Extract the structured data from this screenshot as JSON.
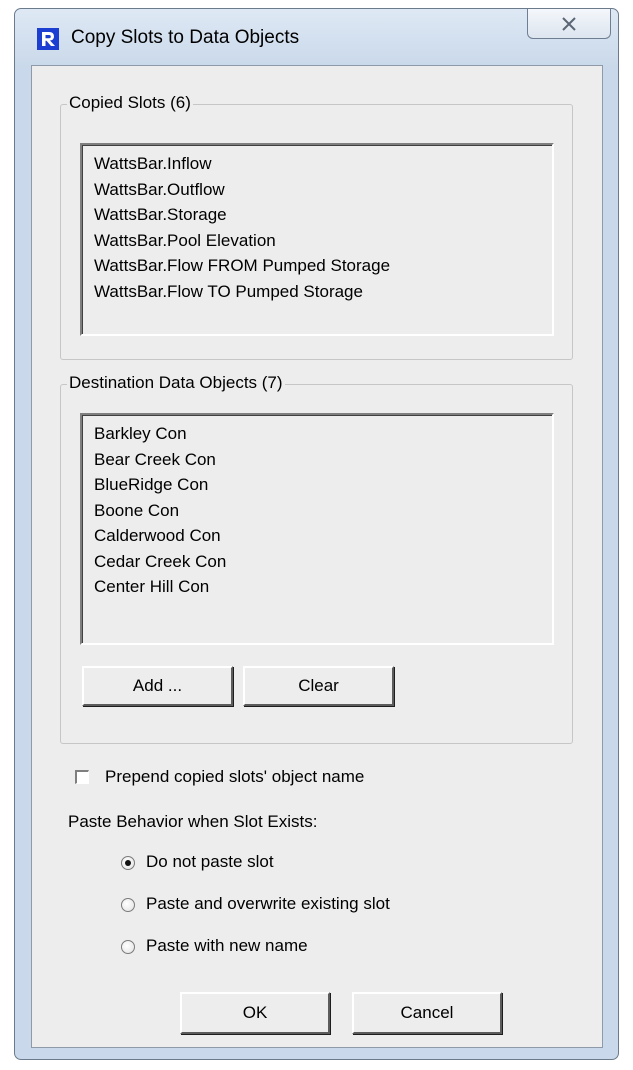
{
  "window": {
    "title": "Copy Slots to Data Objects"
  },
  "copied_slots": {
    "title": "Copied Slots (6)",
    "items": [
      "WattsBar.Inflow",
      "WattsBar.Outflow",
      "WattsBar.Storage",
      "WattsBar.Pool Elevation",
      "WattsBar.Flow FROM Pumped Storage",
      "WattsBar.Flow TO Pumped Storage"
    ]
  },
  "destination": {
    "title": "Destination Data Objects (7)",
    "items": [
      "Barkley Con",
      "Bear Creek Con",
      "BlueRidge Con",
      "Boone Con",
      "Calderwood Con",
      "Cedar Creek Con",
      "Center Hill Con"
    ],
    "add_label": "Add ...",
    "clear_label": "Clear"
  },
  "prepend": {
    "label": "Prepend copied slots' object name",
    "checked": false
  },
  "paste_behavior": {
    "heading": "Paste Behavior when Slot Exists:",
    "options": [
      {
        "label": "Do not paste slot",
        "selected": true
      },
      {
        "label": "Paste and overwrite existing slot",
        "selected": false
      },
      {
        "label": "Paste with new name",
        "selected": false
      }
    ]
  },
  "footer": {
    "ok_label": "OK",
    "cancel_label": "Cancel"
  },
  "icons": {
    "app": "app-logo-icon",
    "close": "close-icon"
  },
  "colors": {
    "app_icon_blue": "#1d3fd1",
    "dialog_bg": "#ededed",
    "frame": "#c9d8ea"
  }
}
